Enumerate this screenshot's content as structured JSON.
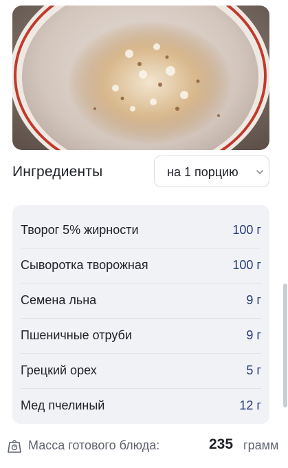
{
  "photo": {
    "alt_icon": "porridge-bowl-photo"
  },
  "ingredients": {
    "title": "Ингредиенты",
    "portion_selected": "на 1 порцию",
    "items": [
      {
        "name": "Творог 5% жирности",
        "amount": "100 г"
      },
      {
        "name": "Сыворотка творожная",
        "amount": "100 г"
      },
      {
        "name": "Семена льна",
        "amount": "9 г"
      },
      {
        "name": "Пшеничные отруби",
        "amount": "9 г"
      },
      {
        "name": "Грецкий орех",
        "amount": "5 г"
      },
      {
        "name": "Мед пчелиный",
        "amount": "12 г"
      }
    ]
  },
  "mass": {
    "label": "Масса готового блюда:",
    "value": "235",
    "unit": "грамм"
  },
  "colors": {
    "amount_text": "#243b7a",
    "card_bg": "#f1f2f5"
  }
}
